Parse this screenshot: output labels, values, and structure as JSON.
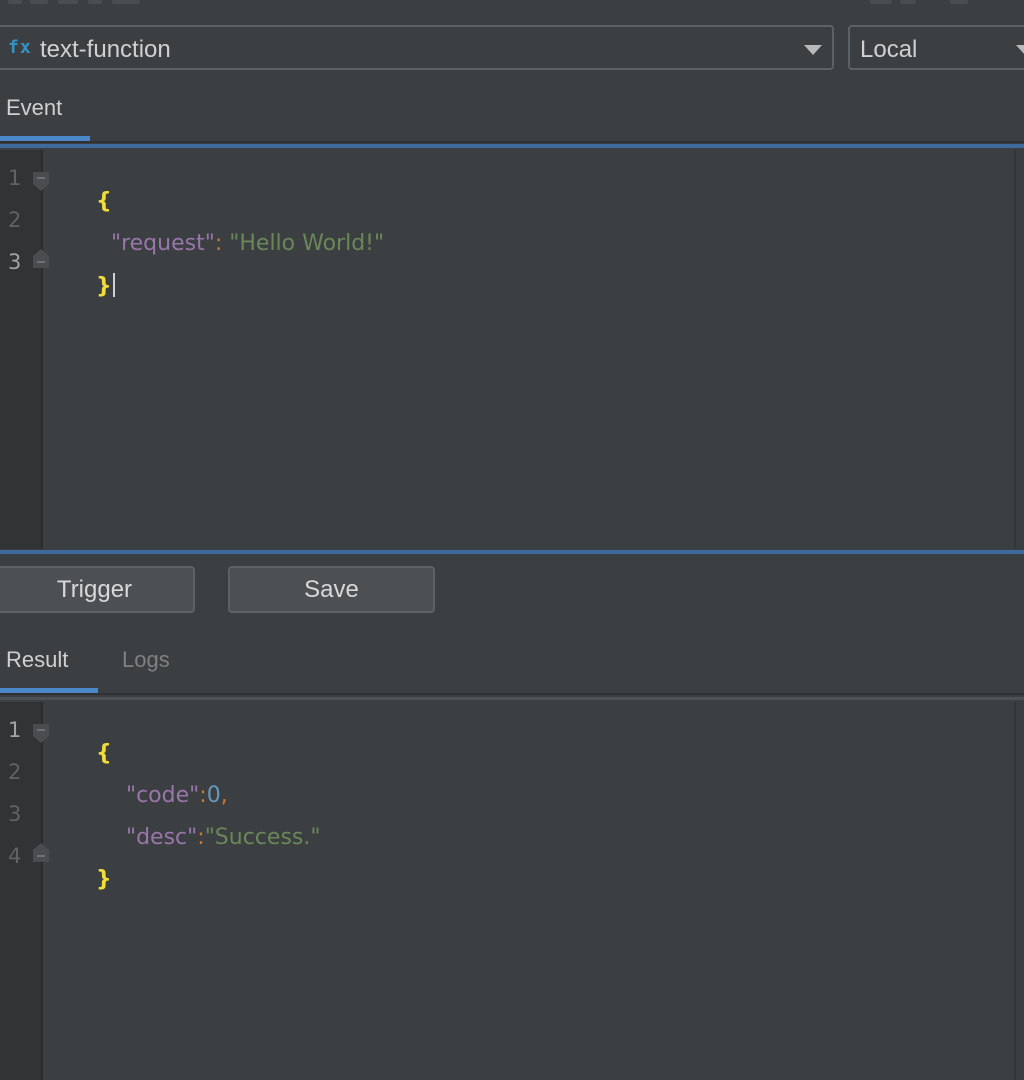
{
  "function_select": {
    "icon": "fx",
    "value": "text-function"
  },
  "env_select": {
    "value": "Local"
  },
  "event_tabs": [
    {
      "label": "Event",
      "active": true
    }
  ],
  "event_editor": {
    "line_numbers": [
      "1",
      "2",
      "3"
    ],
    "lines": {
      "l1_brace": "{",
      "l2_key": "\"request\"",
      "l2_colon": ": ",
      "l2_value": "\"Hello World!\"",
      "l3_brace": "}"
    }
  },
  "buttons": {
    "trigger": "Trigger",
    "save": "Save"
  },
  "result_tabs": [
    {
      "label": "Result",
      "active": true
    },
    {
      "label": "Logs",
      "active": false
    }
  ],
  "result_editor": {
    "line_numbers": [
      "1",
      "2",
      "3",
      "4"
    ],
    "lines": {
      "l1_brace": "{",
      "l2_key": "\"code\"",
      "l2_colon": ":",
      "l2_value": "0",
      "l2_comma": ",",
      "l3_key": "\"desc\"",
      "l3_colon": ":",
      "l3_value": "\"Success.\"",
      "l4_brace": "}"
    }
  },
  "colors": {
    "background": "#3c3f41",
    "gutter": "#313335",
    "accent": "#4a88c7",
    "brace": "#f2dd38",
    "json_key": "#9876aa",
    "json_string": "#6a8759",
    "json_number": "#6897bb",
    "punctuation": "#cc7832"
  },
  "icons": {
    "function_icon": "fx-icon",
    "dropdown": "chevron-down-icon",
    "fold": "fold-marker-icon"
  }
}
